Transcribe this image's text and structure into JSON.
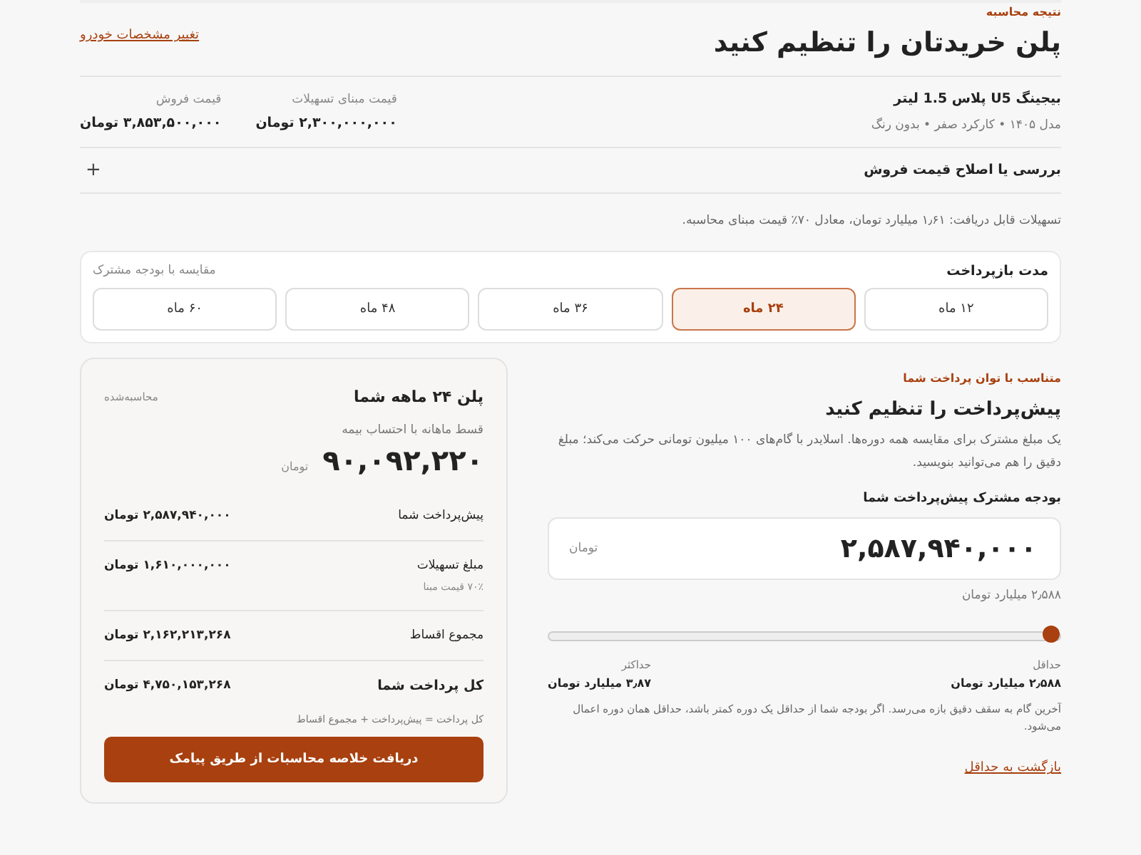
{
  "header": {
    "eyebrow": "نتیجه محاسبه",
    "title": "پلن خریدتان را تنظیم کنید",
    "link": "تغییر مشخصات خودرو"
  },
  "car": {
    "name": "بیجینگ U5 پلاس 1.5 لیتر",
    "details": "مدل ۱۴۰۵ • کارکرد صفر • بدون رنگ",
    "prices": [
      {
        "label": "قیمت مبنای تسهیلات",
        "value": "۲,۳۰۰,۰۰۰,۰۰۰ تومان"
      },
      {
        "label": "قیمت فروش",
        "value": "۳,۸۵۳,۵۰۰,۰۰۰ تومان"
      }
    ]
  },
  "price_review": {
    "label": "بررسی یا اصلاح قیمت فروش",
    "toggle": "+"
  },
  "note": "تسهیلات قابل دریافت: ۱٫۶۱ میلیارد تومان، معادل ۷۰٪ قیمت مبنای محاسبه.",
  "term": {
    "title": "مدت بازپرداخت",
    "hint": "مقایسه با بودجه مشترک",
    "options": [
      {
        "label": "۱۲ ماه",
        "selected": false
      },
      {
        "label": "۲۴ ماه",
        "selected": true
      },
      {
        "label": "۳۶ ماه",
        "selected": false
      },
      {
        "label": "۴۸ ماه",
        "selected": false
      },
      {
        "label": "۶۰ ماه",
        "selected": false
      }
    ]
  },
  "downpayment": {
    "eyebrow": "متناسب با توان پرداخت شما",
    "title": "پیش‌پرداخت را تنظیم کنید",
    "description": "یک مبلغ مشترک برای مقایسه همه دوره‌ها. اسلایدر با گام‌های ۱۰۰ میلیون تومانی حرکت می‌کند؛ مبلغ دقیق را هم می‌توانید بنویسید.",
    "field_label": "بودجه مشترک پیش‌پرداخت شما",
    "value": "۲,۵۸۷,۹۴۰,۰۰۰",
    "unit": "تومان",
    "value_words": "۲٫۵۸۸ میلیارد تومان",
    "slider": {
      "level": 0
    },
    "min": {
      "label": "حداقل",
      "value": "۲٫۵۸۸ میلیارد تومان"
    },
    "max": {
      "label": "حداکثر",
      "value": "۳٫۸۷ میلیارد تومان"
    },
    "hint": "آخرین گام به سقف دقیق بازه می‌رسد. اگر بودجه شما از حداقل یک دوره کمتر باشد، حداقل همان دوره اعمال می‌شود.",
    "reset_link": "بازگشت به حداقل"
  },
  "plan": {
    "title": "پلن ۲۴ ماهه شما",
    "status": "محاسبه‌شده",
    "monthly_label": "قسط ماهانه با احتساب بیمه",
    "monthly_value": "۹۰,۰۹۲,۲۲۰",
    "monthly_unit": "تومان",
    "rows": [
      {
        "label": "پیش‌پرداخت شما",
        "value": "۲,۵۸۷,۹۴۰,۰۰۰ تومان",
        "kind": "normal"
      },
      {
        "label": "مبلغ تسهیلات",
        "sub": "۷۰٪ قیمت مبنا",
        "value": "۱,۶۱۰,۰۰۰,۰۰۰ تومان",
        "kind": "normal"
      },
      {
        "label": "مجموع اقساط",
        "value": "۲,۱۶۲,۲۱۳,۲۶۸ تومان",
        "kind": "normal"
      },
      {
        "label": "کل پرداخت شما",
        "value": "۴,۷۵۰,۱۵۳,۲۶۸ تومان",
        "kind": "total"
      }
    ],
    "formula": "کل پرداخت = پیش‌پرداخت + مجموع اقساط",
    "button": "دریافت خلاصه محاسبات از طریق پیامک"
  }
}
